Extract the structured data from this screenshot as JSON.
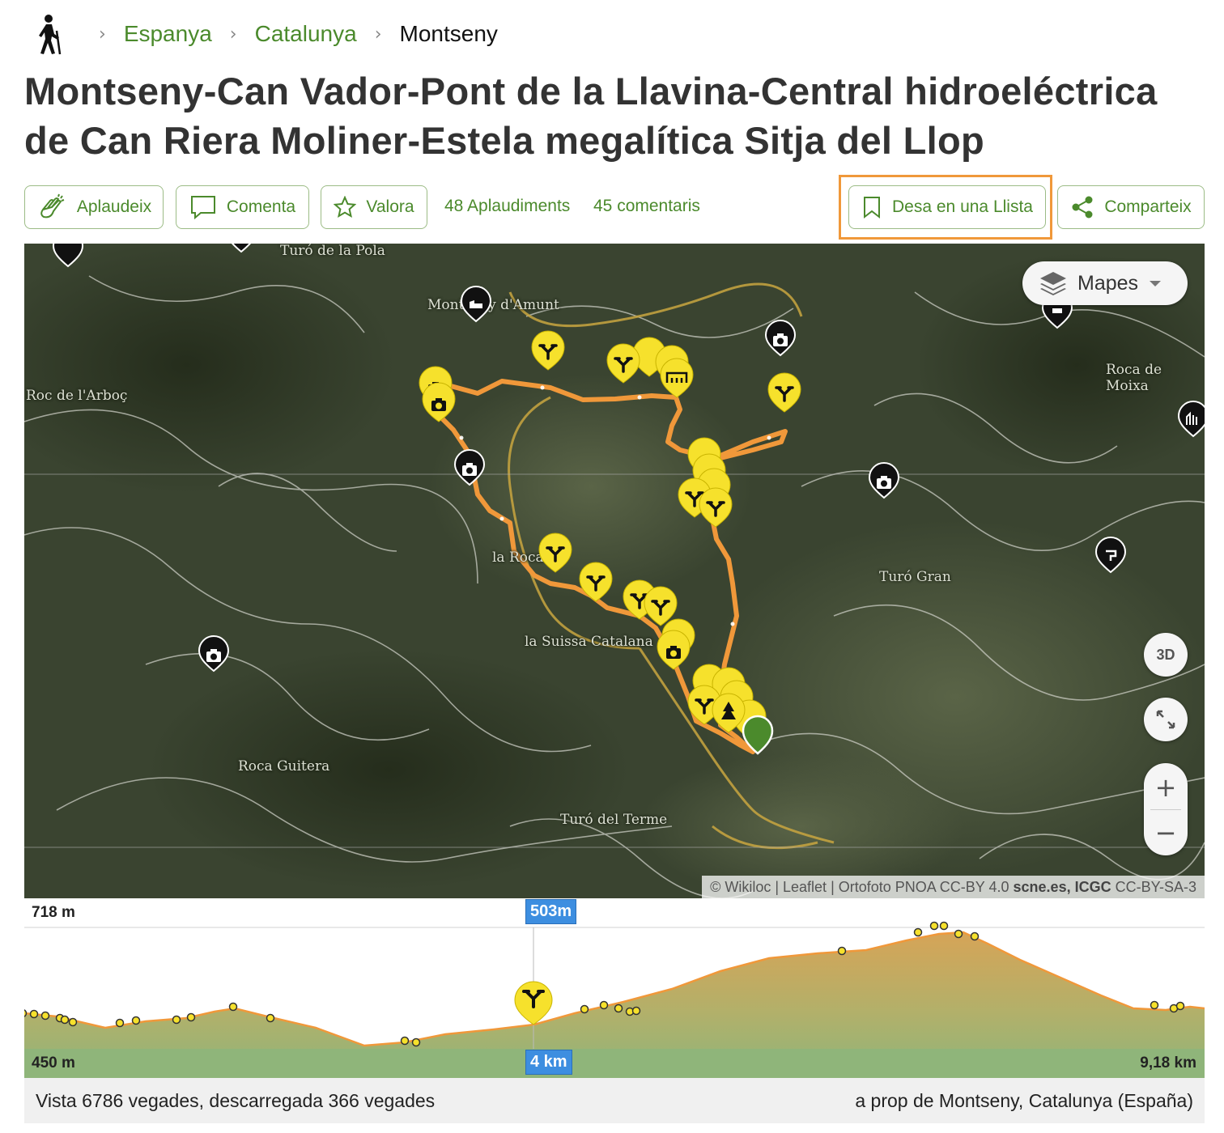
{
  "breadcrumb": {
    "activity_icon": "hiker-icon",
    "items": [
      "Espanya",
      "Catalunya",
      "Montseny"
    ]
  },
  "title": "Montseny-Can Vador-Pont de la Llavina-Central hidroeléctrica de Can Riera Moliner-Estela megalítica Sitja del Llop",
  "actions": {
    "applaud": "Aplaudeix",
    "comment": "Comenta",
    "rate": "Valora",
    "applause_count": "48 Aplaudiments",
    "comment_count": "45 comentaris",
    "save_list": "Desa en una Llista",
    "share": "Comparteix"
  },
  "map": {
    "layers_label": "Mapes",
    "btn_3d": "3D",
    "zoom_in": "+",
    "zoom_out": "−",
    "place_labels": [
      "Turó de la Pola",
      "Montseny d'Amunt",
      "Roc de l'Arboç",
      "Roca de Moixa",
      "la Roca",
      "Turó Gran",
      "la Suissa Catalana",
      "Roca Guitera",
      "Turó del Terme"
    ],
    "attribution": {
      "wikiloc": "© Wikiloc",
      "leaflet": "Leaflet",
      "ortho": "Ortofoto PNOA CC-BY 4.0",
      "scne": "scne.es,",
      "icgc": "ICGC",
      "license": "CC-BY-SA-3"
    },
    "colors": {
      "track": "#f0983a",
      "waypoint": "#f6e12c",
      "start": "#4b8a2c"
    }
  },
  "elevation": {
    "max_label": "718 m",
    "min_label": "450 m",
    "distance_label": "9,18 km",
    "cursor_elevation": "503m",
    "cursor_distance": "4 km"
  },
  "footer": {
    "stats": "Vista 6786 vegades, descarregada 366 vegades",
    "location": "a prop de Montseny, Catalunya (España)"
  }
}
